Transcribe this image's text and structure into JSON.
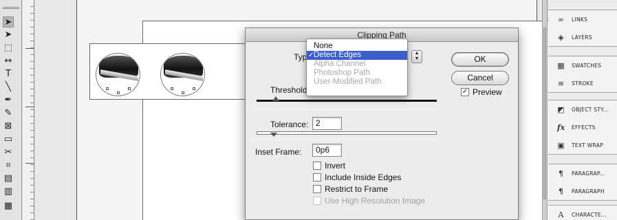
{
  "tools": [
    {
      "name": "selection-tool-icon",
      "glyph": "➤"
    },
    {
      "name": "direct-selection-tool-icon",
      "glyph": "➤"
    },
    {
      "name": "page-tool-icon",
      "glyph": "⬚"
    },
    {
      "name": "gap-tool-icon",
      "glyph": "↔"
    },
    {
      "name": "type-tool-icon",
      "glyph": "T"
    },
    {
      "name": "line-tool-icon",
      "glyph": "╲"
    },
    {
      "name": "pen-tool-icon",
      "glyph": "✒"
    },
    {
      "name": "pencil-tool-icon",
      "glyph": "✎"
    },
    {
      "name": "rectangle-frame-tool-icon",
      "glyph": "⊠"
    },
    {
      "name": "rectangle-tool-icon",
      "glyph": "▭"
    },
    {
      "name": "scissors-tool-icon",
      "glyph": "✂"
    },
    {
      "name": "free-transform-tool-icon",
      "glyph": "⌗"
    },
    {
      "name": "gradient-tool-icon",
      "glyph": "▤"
    },
    {
      "name": "gradient-feather-tool-icon",
      "glyph": "▥"
    },
    {
      "name": "note-tool-icon",
      "glyph": "▦"
    }
  ],
  "dialog": {
    "title": "Clipping Path",
    "type_label": "Type",
    "threshold_label": "Threshold:",
    "tolerance_label": "Tolerance:",
    "tolerance_value": "2",
    "inset_frame_label": "Inset Frame:",
    "inset_frame_value": "0p6",
    "ok_label": "OK",
    "cancel_label": "Cancel",
    "preview_label": "Preview",
    "preview_checked": true,
    "type_options": [
      "None",
      "Detect Edges",
      "Alpha Channel",
      "Photoshop Path",
      "User-Modified Path"
    ],
    "type_selected": "Detect Edges",
    "checkboxes": [
      {
        "label": "Invert",
        "checked": false,
        "enabled": true
      },
      {
        "label": "Include Inside Edges",
        "checked": false,
        "enabled": true
      },
      {
        "label": "Restrict to Frame",
        "checked": false,
        "enabled": true
      },
      {
        "label": "Use High Resolution Image",
        "checked": false,
        "enabled": false
      }
    ]
  },
  "panels": [
    {
      "name": "links",
      "label": "LINKS",
      "icon": "links-icon"
    },
    {
      "name": "layers",
      "label": "LAYERS",
      "icon": "layers-icon"
    },
    {
      "name": "swatches",
      "label": "SWATCHES",
      "icon": "swatches-icon"
    },
    {
      "name": "stroke",
      "label": "STROKE",
      "icon": "stroke-icon"
    },
    {
      "name": "object-styles",
      "label": "OBJECT STY...",
      "icon": "object-styles-icon"
    },
    {
      "name": "effects",
      "label": "EFFECTS",
      "icon": "effects-icon"
    },
    {
      "name": "text-wrap",
      "label": "TEXT WRAP",
      "icon": "text-wrap-icon"
    },
    {
      "name": "paragraph-styles",
      "label": "PARAGRAP...",
      "icon": "paragraph-styles-icon"
    },
    {
      "name": "paragraph",
      "label": "PARAGRAPH",
      "icon": "paragraph-icon"
    },
    {
      "name": "character",
      "label": "CHARACTE...",
      "icon": "character-icon"
    }
  ],
  "colors": {
    "menu_highlight": "#3a5fcd",
    "dialog_bg": "#ececec",
    "canvas_bg": "#ffffff"
  }
}
